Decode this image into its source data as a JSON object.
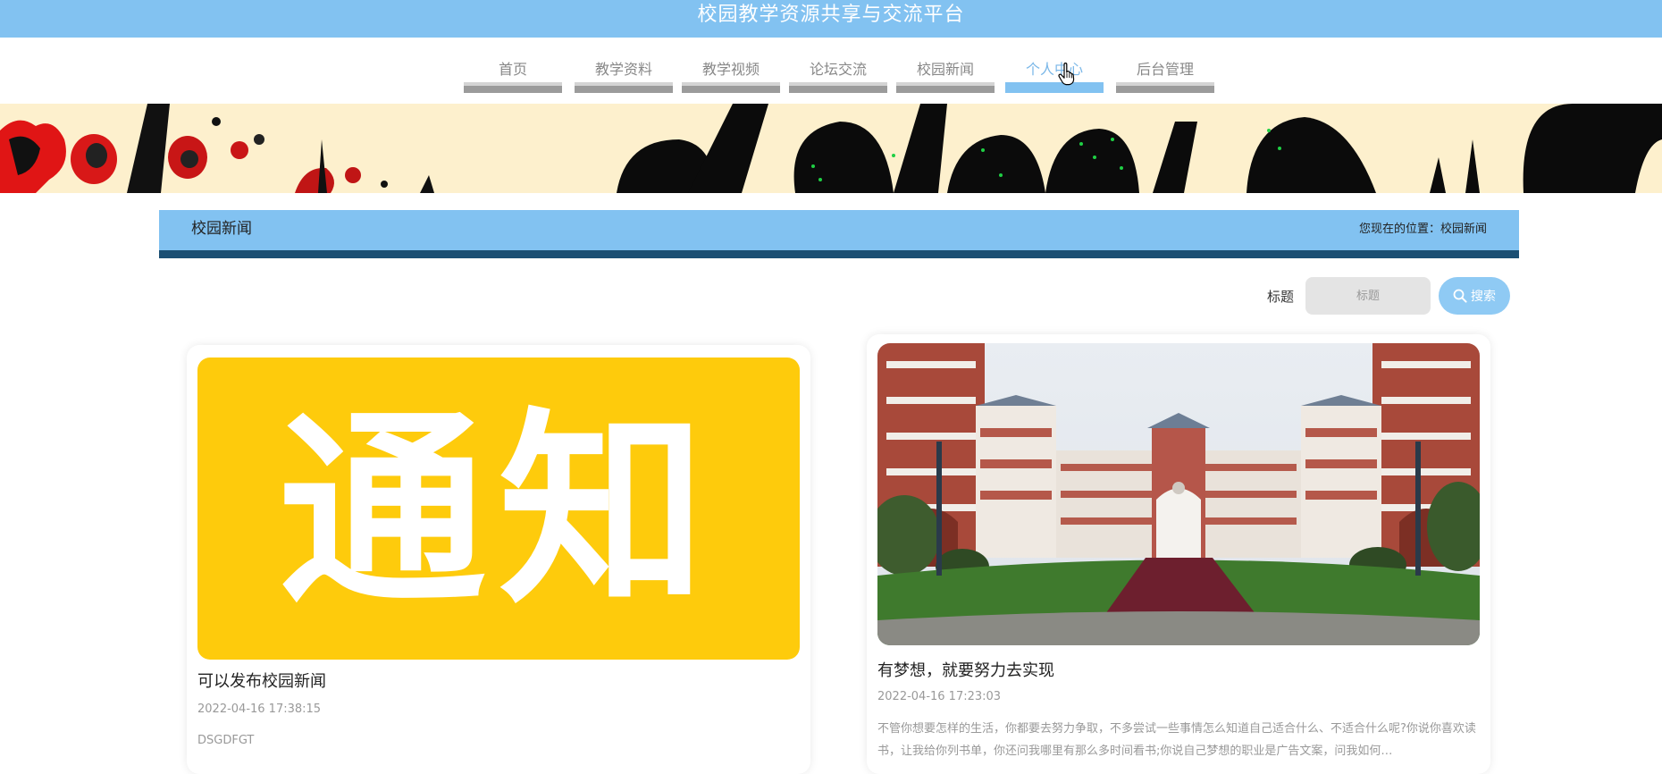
{
  "header": {
    "title": "校园教学资源共享与交流平台"
  },
  "nav": {
    "items": [
      {
        "label": "首页"
      },
      {
        "label": "教学资料"
      },
      {
        "label": "教学视频"
      },
      {
        "label": "论坛交流"
      },
      {
        "label": "校园新闻"
      },
      {
        "label": "个人中心"
      },
      {
        "label": "后台管理"
      }
    ],
    "active_index": 5
  },
  "section": {
    "title": "校园新闻",
    "breadcrumb": "您现在的位置：校园新闻"
  },
  "search": {
    "label": "标题",
    "placeholder": "标题",
    "button_label": "搜索"
  },
  "news": [
    {
      "image_text": "通知",
      "title": "可以发布校园新闻",
      "date": "2022-04-16 17:38:15",
      "summary": "DSGDFGT"
    },
    {
      "title": "有梦想，就要努力去实现",
      "date": "2022-04-16 17:23:03",
      "summary": "不管你想要怎样的生活，你都要去努力争取，不多尝试一些事情怎么知道自己适合什么、不适合什么呢?你说你喜欢读书，让我给你列书单，你还问我哪里有那么多时间看书;你说自己梦想的职业是广告文案，问我如何…"
    }
  ],
  "colors": {
    "header_bg": "#82c2f1",
    "section_bar_border": "#1b4f73",
    "banner_bg": "#fdf0cd",
    "notice_bg": "#fecb0c"
  }
}
